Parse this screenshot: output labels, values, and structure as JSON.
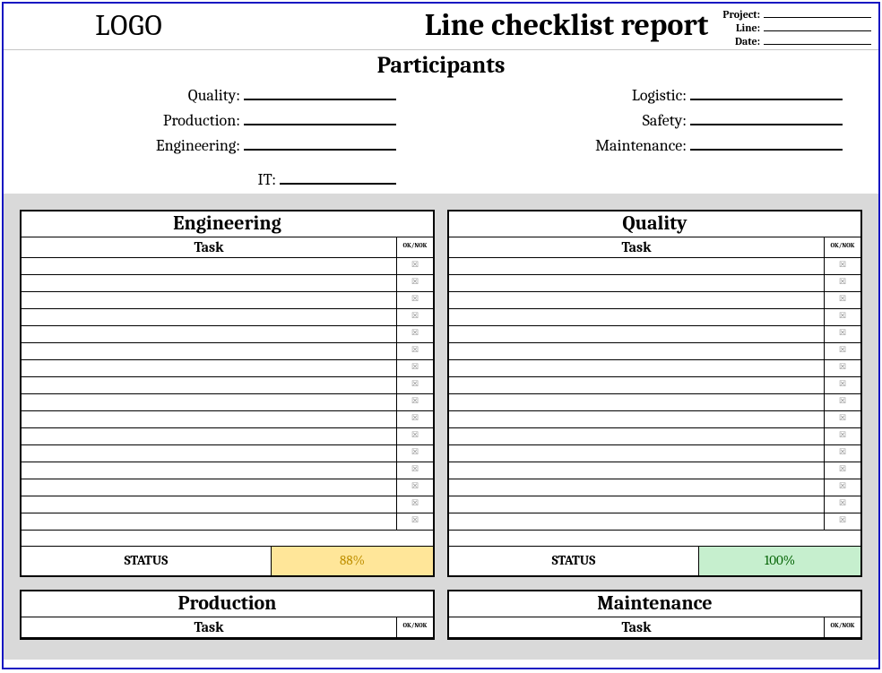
{
  "header": {
    "logo": "LOGO",
    "title": "Line checklist report",
    "meta": {
      "project_label": "Project:",
      "line_label": "Line:",
      "date_label": "Date:",
      "project_value": "",
      "line_value": "",
      "date_value": ""
    }
  },
  "participants": {
    "title": "Participants",
    "left": [
      {
        "label": "Quality:",
        "value": ""
      },
      {
        "label": "Production:",
        "value": ""
      },
      {
        "label": "Engineering:",
        "value": ""
      }
    ],
    "right": [
      {
        "label": "Logistic:",
        "value": ""
      },
      {
        "label": "Safety:",
        "value": ""
      },
      {
        "label": "Maintenance:",
        "value": ""
      }
    ],
    "it": {
      "label": "IT:",
      "value": ""
    }
  },
  "sheets": [
    {
      "title": "Engineering",
      "task_header": "Task",
      "ok_header": "OK/NOK",
      "rows": 16,
      "status_label": "STATUS",
      "status_value": "88%",
      "status_color": "yellow"
    },
    {
      "title": "Quality",
      "task_header": "Task",
      "ok_header": "OK/NOK",
      "rows": 16,
      "status_label": "STATUS",
      "status_value": "100%",
      "status_color": "green"
    },
    {
      "title": "Production",
      "task_header": "Task",
      "ok_header": "OK/NOK"
    },
    {
      "title": "Maintenance",
      "task_header": "Task",
      "ok_header": "OK/NOK"
    }
  ]
}
